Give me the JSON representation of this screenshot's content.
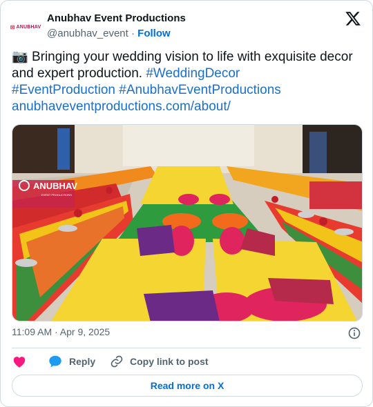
{
  "account": {
    "display_name": "Anubhav Event Productions",
    "handle": "@anubhav_event",
    "separator": "·",
    "follow_label": "Follow",
    "avatar_text": "ANUBHAV"
  },
  "tweet": {
    "emoji": "📷",
    "line1": " Bringing your wedding vision to life with exquisite decor and expert production. ",
    "hashtags": [
      "#WeddingDecor",
      "#EventProduction",
      "#AnubhavEventProductions"
    ],
    "url": "anubhaveventproductions.com/about/"
  },
  "media": {
    "watermark": "ANUBHAV",
    "watermark_sub": "EVENT PRODUCTIONS"
  },
  "timestamp": "11:09 AM · Apr 9, 2025",
  "actions": {
    "reply_label": "Reply",
    "copy_label": "Copy link to post"
  },
  "read_more_label": "Read more on X",
  "colors": {
    "link": "#1b6fc9",
    "follow": "#006fd6",
    "heart": "#f91880",
    "reply_bubble": "#1d9bf0",
    "muted": "#536471"
  }
}
